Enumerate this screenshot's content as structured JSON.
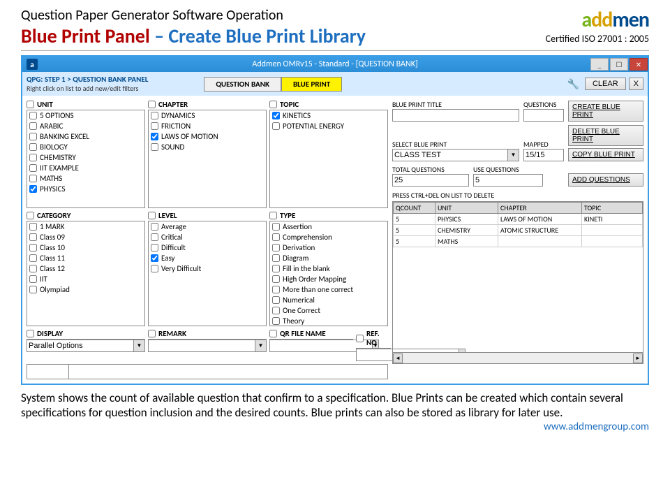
{
  "header": {
    "small_title": "Question Paper Generator Software Operation",
    "title_part1": "Blue Print Panel",
    "title_sep": " – ",
    "title_part2": "Create Blue Print Library",
    "cert": "Certified ISO 27001 : 2005"
  },
  "titlebar": {
    "app_icon": "a",
    "title": "Addmen OMRv15 - Standard - [QUESTION BANK]",
    "min": "_",
    "max": "☐",
    "close": "✕"
  },
  "toolbar": {
    "breadcrumb": "QPG: STEP 1 > QUESTION BANK PANEL",
    "hint": "Right click on list to add new/edit filters",
    "tab_q": "QUESTION BANK",
    "tab_bp": "BLUE PRINT",
    "clear": "CLEAR",
    "close_x": "X"
  },
  "panels": {
    "unit": {
      "label": "UNIT",
      "items": [
        {
          "t": "5 OPTIONS",
          "c": false
        },
        {
          "t": "ARABIC",
          "c": false
        },
        {
          "t": "BANKING EXCEL",
          "c": false
        },
        {
          "t": "BIOLOGY",
          "c": false
        },
        {
          "t": "CHEMISTRY",
          "c": false
        },
        {
          "t": "IIT EXAMPLE",
          "c": false
        },
        {
          "t": "MATHS",
          "c": false
        },
        {
          "t": "PHYSICS",
          "c": true
        }
      ]
    },
    "chapter": {
      "label": "CHAPTER",
      "items": [
        {
          "t": "DYNAMICS",
          "c": false
        },
        {
          "t": "FRICTION",
          "c": false
        },
        {
          "t": "LAWS OF MOTION",
          "c": true
        },
        {
          "t": "SOUND",
          "c": false
        }
      ]
    },
    "topic": {
      "label": "TOPIC",
      "items": [
        {
          "t": "KINETICS",
          "c": true
        },
        {
          "t": "POTENTIAL ENERGY",
          "c": false
        }
      ]
    },
    "category": {
      "label": "CATEGORY",
      "items": [
        {
          "t": "1 MARK",
          "c": false
        },
        {
          "t": "Class 09",
          "c": false
        },
        {
          "t": "Class 10",
          "c": false
        },
        {
          "t": "Class 11",
          "c": false
        },
        {
          "t": "Class 12",
          "c": false
        },
        {
          "t": "IIT",
          "c": false
        },
        {
          "t": "Olympiad",
          "c": false
        }
      ]
    },
    "level": {
      "label": "LEVEL",
      "items": [
        {
          "t": "Average",
          "c": false
        },
        {
          "t": "Critical",
          "c": false
        },
        {
          "t": "Difficult",
          "c": false
        },
        {
          "t": "Easy",
          "c": true
        },
        {
          "t": "Very Difficult",
          "c": false
        }
      ]
    },
    "type": {
      "label": "TYPE",
      "items": [
        {
          "t": "Assertion",
          "c": false
        },
        {
          "t": "Comprehension",
          "c": false
        },
        {
          "t": "Derivation",
          "c": false
        },
        {
          "t": "Diagram",
          "c": false
        },
        {
          "t": "Fill in the blank",
          "c": false
        },
        {
          "t": "High Order Mapping",
          "c": false
        },
        {
          "t": "More than one correct",
          "c": false
        },
        {
          "t": "Numerical",
          "c": false
        },
        {
          "t": "One Correct",
          "c": false
        },
        {
          "t": "Theory",
          "c": false
        }
      ]
    },
    "display": {
      "label": "DISPLAY",
      "value": "Parallel Options"
    },
    "remark": {
      "label": "REMARK",
      "value": ""
    },
    "qrfile": {
      "label": "QR FILE NAME",
      "value": ""
    },
    "refno": {
      "label": "REF. NO",
      "value": ""
    }
  },
  "right": {
    "bp_title_label": "BLUE PRINT TITLE",
    "bp_title_value": "",
    "questions_label": "QUESTIONS",
    "questions_value": "",
    "select_bp_label": "SELECT BLUE PRINT",
    "select_bp_value": "CLASS TEST",
    "mapped_label": "MAPPED",
    "mapped_value": "15/15",
    "total_q_label": "TOTAL QUESTIONS",
    "total_q_value": "25",
    "use_q_label": "USE QUESTIONS",
    "use_q_value": "5",
    "del_hint": "PRESS CTRL+DEL ON LIST TO DELETE",
    "btn_create": "CREATE BLUE PRINT",
    "btn_delete": "DELETE BLUE PRINT",
    "btn_copy": "COPY BLUE PRINT",
    "btn_addq": "ADD QUESTIONS",
    "table": {
      "cols": [
        "QCOUNT",
        "UNIT",
        "CHAPTER",
        "TOPIC"
      ],
      "rows": [
        {
          "qcount": "5",
          "unit": "PHYSICS",
          "chapter": "LAWS OF MOTION",
          "topic": "KINETI"
        },
        {
          "qcount": "5",
          "unit": "CHEMISTRY",
          "chapter": "ATOMIC STRUCTURE",
          "topic": ""
        },
        {
          "qcount": "5",
          "unit": "MATHS",
          "chapter": "",
          "topic": ""
        }
      ]
    }
  },
  "footer": {
    "text": "System shows the count of available question that confirm to a specification. Blue Prints can be created which contain several specifications for question inclusion and the desired counts. Blue prints can also be stored as library for later use.",
    "link": "www.addmengroup.com"
  }
}
